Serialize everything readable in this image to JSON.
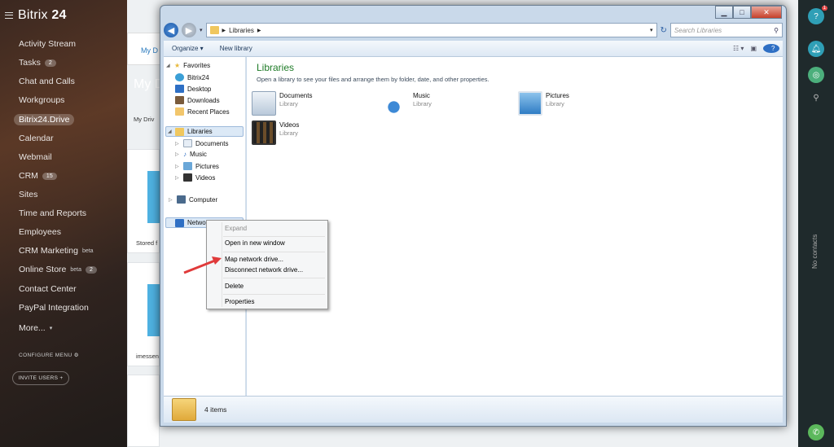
{
  "portal": {
    "logo_prefix": "Bitrix",
    "logo_suffix": "24",
    "nav": [
      {
        "label": "Activity Stream"
      },
      {
        "label": "Tasks",
        "badge": "2"
      },
      {
        "label": "Chat and Calls"
      },
      {
        "label": "Workgroups"
      },
      {
        "label": "Bitrix24.Drive",
        "active": true
      },
      {
        "label": "Calendar"
      },
      {
        "label": "Webmail"
      },
      {
        "label": "CRM",
        "badge": "15"
      },
      {
        "label": "Sites"
      },
      {
        "label": "Time and Reports"
      },
      {
        "label": "Employees"
      },
      {
        "label": "CRM Marketing",
        "sup": "beta"
      },
      {
        "label": "Online Store",
        "sup": "beta",
        "badge": "2"
      },
      {
        "label": "Contact Center"
      },
      {
        "label": "PayPal Integration"
      },
      {
        "label": "More...",
        "sup": "▾"
      }
    ],
    "configure_menu": "CONFIGURE MENU",
    "invite_users": "INVITE USERS",
    "right": {
      "help": "?",
      "help_badge": "1",
      "no_contacts": "No contacts"
    },
    "page_tab": "My D",
    "page_title": "My D",
    "page_crumb": "My Driv",
    "card1_label": "Stored f",
    "card2_label": "imessen"
  },
  "explorer": {
    "address_path": "Libraries",
    "search_placeholder": "Search Libraries",
    "toolbar": {
      "organize": "Organize ▾",
      "new_library": "New library"
    },
    "nav_pane": {
      "favorites": "Favorites",
      "fav_items": [
        "Bitrix24",
        "Desktop",
        "Downloads",
        "Recent Places"
      ],
      "libraries": "Libraries",
      "lib_items": [
        "Documents",
        "Music",
        "Pictures",
        "Videos"
      ],
      "computer": "Computer",
      "network": "Network"
    },
    "content": {
      "title": "Libraries",
      "subtitle": "Open a library to see your files and arrange them by folder, date, and other properties.",
      "items": [
        {
          "name": "Documents",
          "type": "Library"
        },
        {
          "name": "Music",
          "type": "Library"
        },
        {
          "name": "Pictures",
          "type": "Library"
        },
        {
          "name": "Videos",
          "type": "Library"
        }
      ]
    },
    "status": "4 items"
  },
  "context_menu": {
    "expand": "Expand",
    "open_new_window": "Open in new window",
    "map_drive": "Map network drive...",
    "disconnect_drive": "Disconnect network drive...",
    "delete": "Delete",
    "properties": "Properties"
  },
  "colors": {
    "accent_green": "#1e7b27",
    "arrow_red": "#e03a3a",
    "selection": "#dce9f6"
  }
}
